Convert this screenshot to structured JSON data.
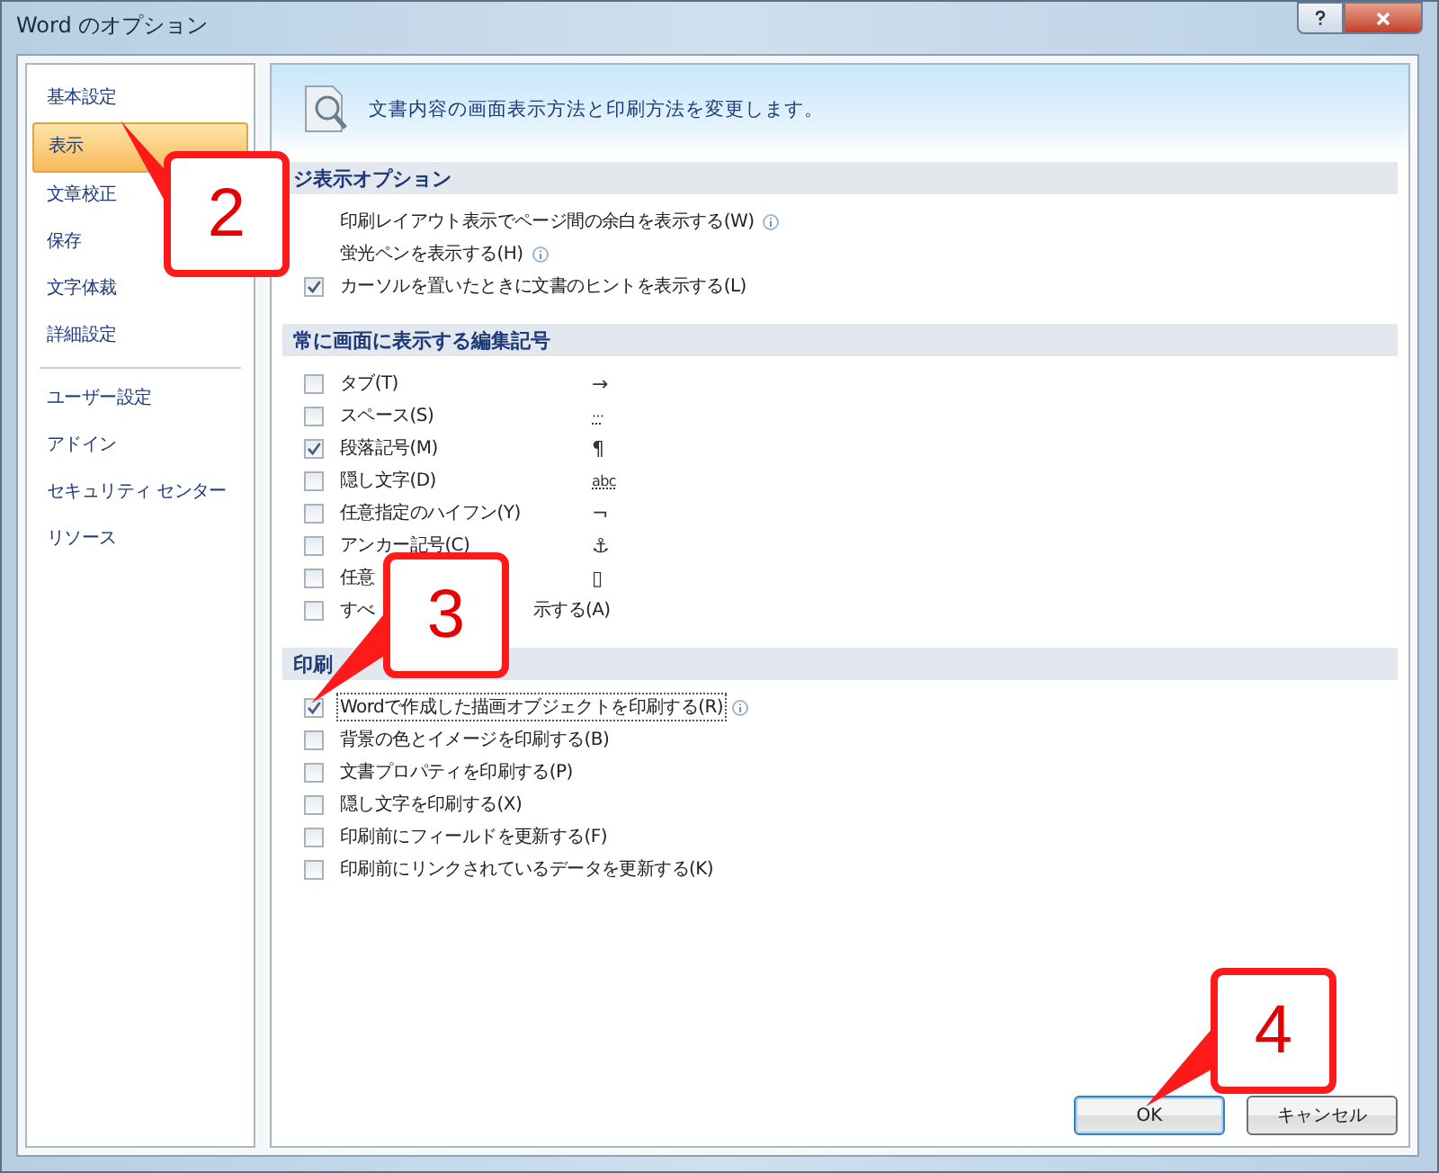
{
  "window": {
    "title": "Word のオプション"
  },
  "sidebar": {
    "groups": [
      [
        {
          "label": "基本設定",
          "selected": false
        },
        {
          "label": "表示",
          "selected": true
        },
        {
          "label": "文章校正",
          "selected": false
        },
        {
          "label": "保存",
          "selected": false
        },
        {
          "label": "文字体裁",
          "selected": false
        },
        {
          "label": "詳細設定",
          "selected": false
        }
      ],
      [
        {
          "label": "ユーザー設定",
          "selected": false
        },
        {
          "label": "アドイン",
          "selected": false
        },
        {
          "label": "セキュリティ センター",
          "selected": false
        },
        {
          "label": "リソース",
          "selected": false
        }
      ]
    ]
  },
  "header": {
    "text": "文書内容の画面表示方法と印刷方法を変更します。"
  },
  "sections": [
    {
      "title": "ジ表示オプション",
      "items": [
        {
          "label": "印刷レイアウト表示でページ間の余白を表示する(W)",
          "info": true
        },
        {
          "label": "蛍光ペンを表示する(H)",
          "info": true
        },
        {
          "label": "カーソルを置いたときに文書のヒントを表示する(L)",
          "checked": true
        }
      ]
    },
    {
      "title": "常に画面に表示する編集記号",
      "items": [
        {
          "label": "タブ(T)",
          "checked": false,
          "symbol": "→"
        },
        {
          "label": "スペース(S)",
          "checked": false,
          "symbol": "···"
        },
        {
          "label": "段落記号(M)",
          "checked": true,
          "symbol": "¶"
        },
        {
          "label": "隠し文字(D)",
          "checked": false,
          "symbol": "abc"
        },
        {
          "label": "任意指定のハイフン(Y)",
          "checked": false,
          "symbol": "¬"
        },
        {
          "label": "アンカー記号(C)",
          "checked": false,
          "symbol": "⚓"
        },
        {
          "label": "任意",
          "checked": false,
          "symbol": "▯"
        },
        {
          "label": "すべ",
          "tail": "示する(A)",
          "checked": false
        }
      ]
    },
    {
      "title": "印刷",
      "items": [
        {
          "label": "Wordで作成した描画オブジェクトを印刷する(R)",
          "checked": true,
          "focused": true,
          "info": true
        },
        {
          "label": "背景の色とイメージを印刷する(B)",
          "checked": false
        },
        {
          "label": "文書プロパティを印刷する(P)",
          "checked": false
        },
        {
          "label": "隠し文字を印刷する(X)",
          "checked": false
        },
        {
          "label": "印刷前にフィールドを更新する(F)",
          "checked": false
        },
        {
          "label": "印刷前にリンクされているデータを更新する(K)",
          "checked": false
        }
      ]
    }
  ],
  "buttons": [
    {
      "label": "OK",
      "kind": "default"
    },
    {
      "label": "キャンセル",
      "kind": "normal"
    }
  ],
  "callouts": [
    {
      "label": "2"
    },
    {
      "label": "3"
    },
    {
      "label": "4"
    }
  ]
}
